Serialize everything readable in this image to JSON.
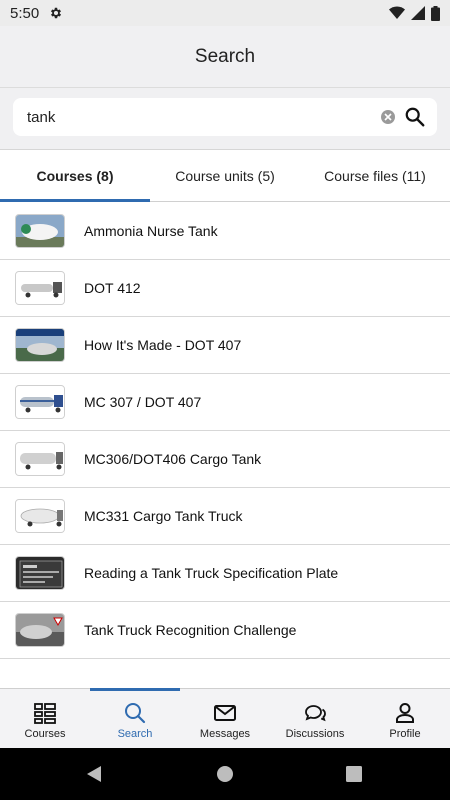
{
  "status_bar": {
    "time": "5:50"
  },
  "header": {
    "title": "Search"
  },
  "search": {
    "query": "tank"
  },
  "tabs": [
    {
      "label": "Courses (8)",
      "active": true
    },
    {
      "label": "Course units (5)",
      "active": false
    },
    {
      "label": "Course files (11)",
      "active": false
    }
  ],
  "results": [
    {
      "title": "Ammonia Nurse Tank"
    },
    {
      "title": "DOT 412"
    },
    {
      "title": "How It's Made - DOT 407"
    },
    {
      "title": "MC 307 / DOT 407"
    },
    {
      "title": "MC306/DOT406 Cargo Tank"
    },
    {
      "title": "MC331 Cargo Tank Truck"
    },
    {
      "title": "Reading a Tank Truck Specification Plate"
    },
    {
      "title": "Tank Truck Recognition Challenge"
    }
  ],
  "bottom_nav": [
    {
      "label": "Courses",
      "icon": "grid-list-icon"
    },
    {
      "label": "Search",
      "icon": "search-icon",
      "active": true
    },
    {
      "label": "Messages",
      "icon": "envelope-icon"
    },
    {
      "label": "Discussions",
      "icon": "chat-bubbles-icon"
    },
    {
      "label": "Profile",
      "icon": "person-icon"
    }
  ],
  "colors": {
    "accent": "#2f6bb0",
    "header_bg": "#f0f0f2",
    "system_nav_bg": "#000000"
  }
}
